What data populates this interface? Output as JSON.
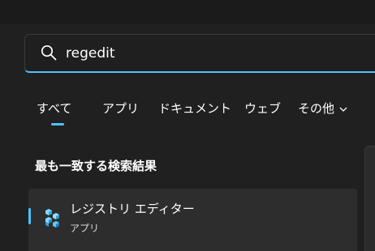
{
  "search": {
    "value": "regedit",
    "icon": "search-icon"
  },
  "tabs": [
    {
      "label": "すべて",
      "selected": true
    },
    {
      "label": "アプリ"
    },
    {
      "label": "ドキュメント"
    },
    {
      "label": "ウェブ"
    },
    {
      "label": "その他",
      "icon": "chevron-down-icon"
    }
  ],
  "best_match": {
    "heading": "最も一致する検索結果",
    "title": "レジストリ エディター",
    "subtitle": "アプリ",
    "icon": "registry-editor-icon"
  },
  "colors": {
    "background": "#202020",
    "accent": "#4cc2ff",
    "result_background": "#2d2d2d"
  }
}
